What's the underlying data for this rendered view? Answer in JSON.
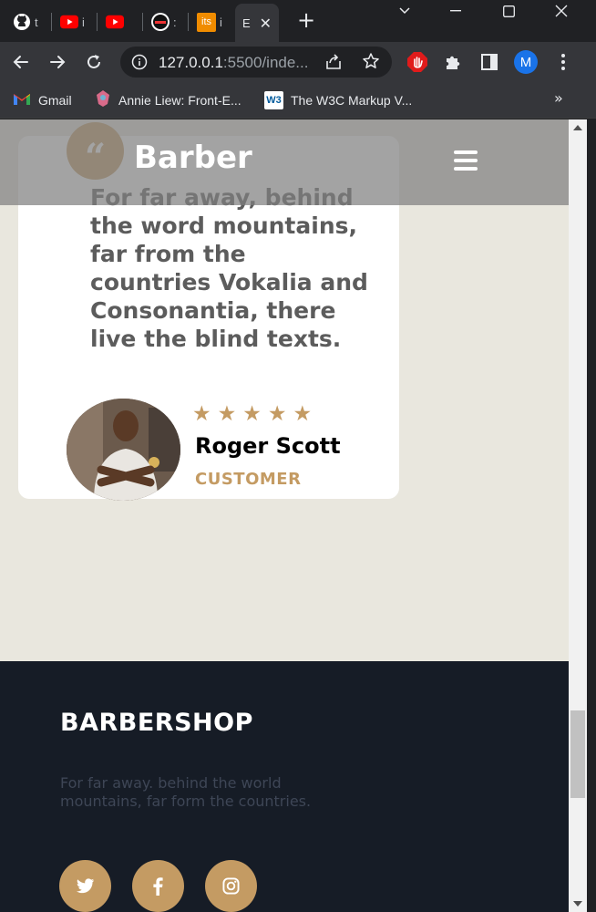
{
  "browser": {
    "tabs": [
      {
        "icon": "github-icon",
        "title": "t"
      },
      {
        "icon": "youtube-icon",
        "title": "i"
      },
      {
        "icon": "youtube-icon",
        "title": ""
      },
      {
        "icon": "ninja-icon",
        "title": ":"
      },
      {
        "icon": "its-icon",
        "badge": "its",
        "title": "i"
      },
      {
        "icon": "page-icon",
        "title": "E",
        "active": true
      }
    ],
    "url_host": "127.0.0.1",
    "url_rest": ":5500/inde...",
    "profile_initial": "M",
    "bookmarks": [
      {
        "icon": "gmail-icon",
        "label": "Gmail"
      },
      {
        "icon": "annie-icon",
        "label": "Annie Liew: Front-E..."
      },
      {
        "icon": "w3c-icon",
        "badge": "W3",
        "label": "The W3C Markup V..."
      }
    ],
    "more_bookmarks": "»"
  },
  "site": {
    "brand": "Barber",
    "testimonial": {
      "quote_mark": "“",
      "text": "For far away, behind the word mountains, far from the countries Vokalia and Consonantia, there live the blind texts.",
      "rating": 5,
      "stars": "★★★★★",
      "name": "Roger Scott",
      "role": "CUSTOMER"
    },
    "footer": {
      "title": "BARBERSHOP",
      "text": "For far away. behind the world mountains, far form the countries.",
      "social": [
        "twitter-icon",
        "facebook-icon",
        "instagram-icon"
      ]
    }
  },
  "colors": {
    "accent": "#c49b63",
    "page_bg": "#e9e7de",
    "footer_bg": "#161c26"
  }
}
